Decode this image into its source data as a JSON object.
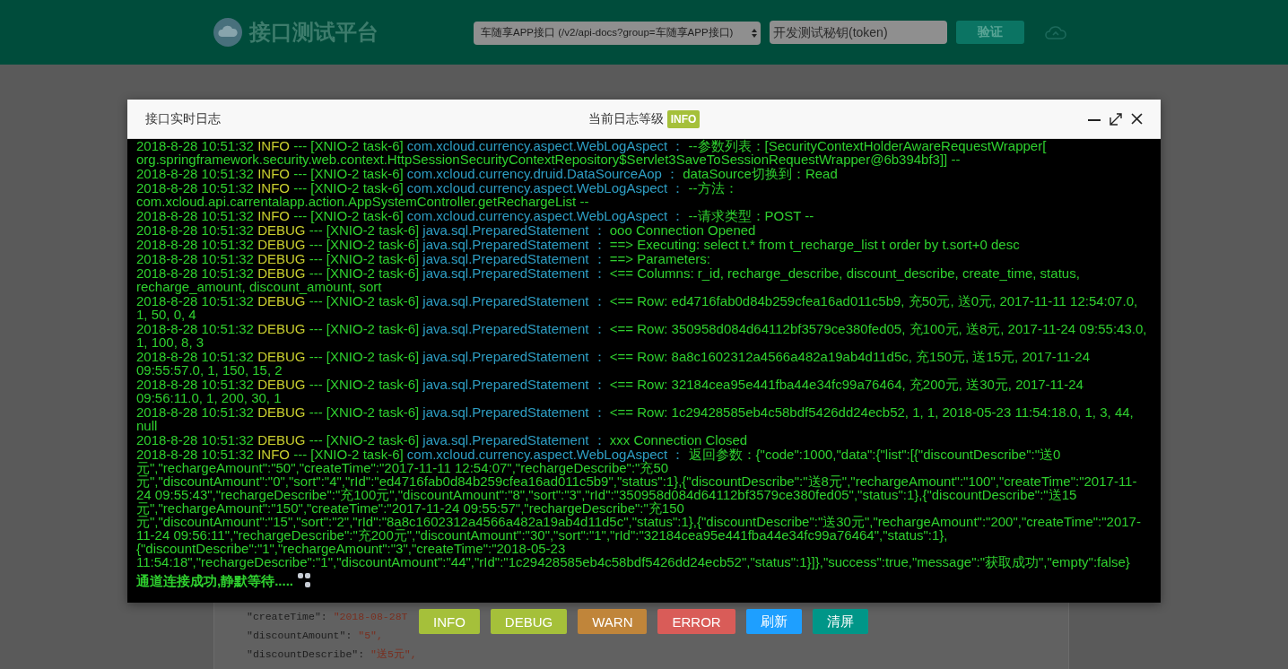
{
  "header": {
    "title": "接口测试平台",
    "api_select": "车随享APP接口 (/v2/api-docs?group=车随享APP接口)",
    "token_field": {
      "placeholder": "开发测试秘钥(token)"
    },
    "verify_button": "验证"
  },
  "background_doc": {
    "lines": [
      {
        "key": "\"createTime\":",
        "value": "\"2018-08-28T"
      },
      {
        "key": "\"discountAmount\":",
        "value": "\"5\","
      },
      {
        "key": "\"discountDescribe\":",
        "value": "\"送5元\","
      }
    ]
  },
  "log_dialog": {
    "title": "接口实时日志",
    "level_label": "当前日志等级",
    "level_badge": "INFO",
    "entries": [
      {
        "time": "2018-8-28 10:51:32",
        "level": "INFO",
        "thread": "--- [XNIO-2 task-6]",
        "logger": "com.xcloud.currency.aspect.WebLogAspect ：",
        "message": " --参数列表：[SecurityContextHolderAwareRequestWrapper[ org.springframework.security.web.context.HttpSessionSecurityContextRepository$Servlet3SaveToSessionRequestWrapper@6b394bf3]] --"
      },
      {
        "time": "2018-8-28 10:51:32",
        "level": "INFO",
        "thread": "--- [XNIO-2 task-6]",
        "logger": "com.xcloud.currency.druid.DataSourceAop ：",
        "message": "dataSource切换到：Read"
      },
      {
        "time": "2018-8-28 10:51:32",
        "level": "INFO",
        "thread": "--- [XNIO-2 task-6]",
        "logger": "com.xcloud.currency.aspect.WebLogAspect ：",
        "message": " --方法： com.xcloud.api.carrentalapp.action.AppSystemController.getRechargeList --"
      },
      {
        "time": "2018-8-28 10:51:32",
        "level": "INFO",
        "thread": "--- [XNIO-2 task-6]",
        "logger": "com.xcloud.currency.aspect.WebLogAspect ：",
        "message": " --请求类型：POST --"
      },
      {
        "time": "2018-8-28 10:51:32",
        "level": "DEBUG",
        "thread": "--- [XNIO-2 task-6]",
        "logger": "java.sql.PreparedStatement ：",
        "message": "ooo Connection Opened"
      },
      {
        "time": "2018-8-28 10:51:32",
        "level": "DEBUG",
        "thread": "--- [XNIO-2 task-6]",
        "logger": "java.sql.PreparedStatement ：",
        "message": "==>  Executing: select t.* from t_recharge_list t order by t.sort+0 desc"
      },
      {
        "time": "2018-8-28 10:51:32",
        "level": "DEBUG",
        "thread": "--- [XNIO-2 task-6]",
        "logger": "java.sql.PreparedStatement ：",
        "message": "==> Parameters:"
      },
      {
        "time": "2018-8-28 10:51:32",
        "level": "DEBUG",
        "thread": "--- [XNIO-2 task-6]",
        "logger": "java.sql.PreparedStatement ：",
        "message": "<==    Columns: r_id, recharge_describe, discount_describe, create_time, status, recharge_amount, discount_amount, sort"
      },
      {
        "time": "2018-8-28 10:51:32",
        "level": "DEBUG",
        "thread": "--- [XNIO-2 task-6]",
        "logger": "java.sql.PreparedStatement ：",
        "message": "<==        Row: ed4716fab0d84b259cfea16ad011c5b9, 充50元, 送0元, 2017-11-11 12:54:07.0, 1, 50, 0, 4"
      },
      {
        "time": "2018-8-28 10:51:32",
        "level": "DEBUG",
        "thread": "--- [XNIO-2 task-6]",
        "logger": "java.sql.PreparedStatement ：",
        "message": "<==        Row: 350958d084d64112bf3579ce380fed05, 充100元, 送8元, 2017-11-24 09:55:43.0, 1, 100, 8, 3"
      },
      {
        "time": "2018-8-28 10:51:32",
        "level": "DEBUG",
        "thread": "--- [XNIO-2 task-6]",
        "logger": "java.sql.PreparedStatement ：",
        "message": "<==        Row: 8a8c1602312a4566a482a19ab4d11d5c, 充150元, 送15元, 2017-11-24 09:55:57.0, 1, 150, 15, 2"
      },
      {
        "time": "2018-8-28 10:51:32",
        "level": "DEBUG",
        "thread": "--- [XNIO-2 task-6]",
        "logger": "java.sql.PreparedStatement ：",
        "message": "<==        Row: 32184cea95e441fba44e34fc99a76464, 充200元, 送30元, 2017-11-24 09:56:11.0, 1, 200, 30, 1"
      },
      {
        "time": "2018-8-28 10:51:32",
        "level": "DEBUG",
        "thread": "--- [XNIO-2 task-6]",
        "logger": "java.sql.PreparedStatement ：",
        "message": "<==        Row: 1c29428585eb4c58bdf5426dd24ecb52, 1, 1, 2018-05-23 11:54:18.0, 1, 3, 44, null"
      },
      {
        "time": "2018-8-28 10:51:32",
        "level": "DEBUG",
        "thread": "--- [XNIO-2 task-6]",
        "logger": "java.sql.PreparedStatement ：",
        "message": "xxx Connection Closed"
      },
      {
        "time": "2018-8-28 10:51:32",
        "level": "INFO",
        "thread": "--- [XNIO-2 task-6]",
        "logger": "com.xcloud.currency.aspect.WebLogAspect ：",
        "message": " 返回参数：{\"code\":1000,\"data\":{\"list\":[{\"discountDescribe\":\"送0元\",\"rechargeAmount\":\"50\",\"createTime\":\"2017-11-11 12:54:07\",\"rechargeDescribe\":\"充50元\",\"discountAmount\":\"0\",\"sort\":\"4\",\"rId\":\"ed4716fab0d84b259cfea16ad011c5b9\",\"status\":1},{\"discountDescribe\":\"送8元\",\"rechargeAmount\":\"100\",\"createTime\":\"2017-11-24 09:55:43\",\"rechargeDescribe\":\"充100元\",\"discountAmount\":\"8\",\"sort\":\"3\",\"rId\":\"350958d084d64112bf3579ce380fed05\",\"status\":1},{\"discountDescribe\":\"送15元\",\"rechargeAmount\":\"150\",\"createTime\":\"2017-11-24 09:55:57\",\"rechargeDescribe\":\"充150元\",\"discountAmount\":\"15\",\"sort\":\"2\",\"rId\":\"8a8c1602312a4566a482a19ab4d11d5c\",\"status\":1},{\"discountDescribe\":\"送30元\",\"rechargeAmount\":\"200\",\"createTime\":\"2017-11-24 09:56:11\",\"rechargeDescribe\":\"充200元\",\"discountAmount\":\"30\",\"sort\":\"1\",\"rId\":\"32184cea95e441fba44e34fc99a76464\",\"status\":1},{\"discountDescribe\":\"1\",\"rechargeAmount\":\"3\",\"createTime\":\"2018-05-23 11:54:18\",\"rechargeDescribe\":\"1\",\"discountAmount\":\"44\",\"rId\":\"1c29428585eb4c58bdf5426dd24ecb52\",\"status\":1}]},\"success\":true,\"message\":\"获取成功\",\"empty\":false}"
      }
    ],
    "status_line": "通道连接成功,静默等待....."
  },
  "level_buttons": [
    {
      "label": "INFO",
      "color": "#a5c03a"
    },
    {
      "label": "DEBUG",
      "color": "#a5c03a"
    },
    {
      "label": "WARN",
      "color": "#c0853a"
    },
    {
      "label": "ERROR",
      "color": "#d95c58"
    },
    {
      "label": "刷新",
      "color": "#1e9fff"
    },
    {
      "label": "清屏",
      "color": "#009688"
    }
  ]
}
